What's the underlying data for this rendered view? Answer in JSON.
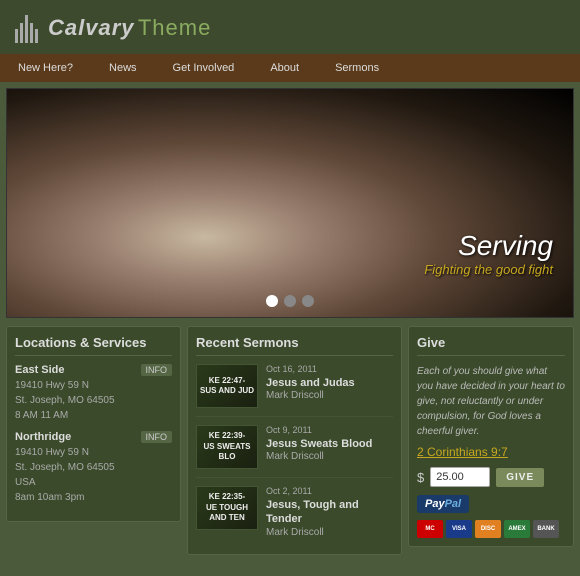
{
  "header": {
    "logo_calvary": "Calvary",
    "logo_theme": "Theme"
  },
  "nav": {
    "items": [
      {
        "label": "New Here?",
        "href": "#"
      },
      {
        "label": "News",
        "href": "#"
      },
      {
        "label": "Get Involved",
        "href": "#"
      },
      {
        "label": "About",
        "href": "#"
      },
      {
        "label": "Sermons",
        "href": "#"
      }
    ]
  },
  "hero": {
    "title": "Serving",
    "subtitle": "Fighting the good fight",
    "dots": [
      {
        "active": true
      },
      {
        "active": false
      },
      {
        "active": false
      }
    ]
  },
  "locations": {
    "section_title": "Locations & Services",
    "items": [
      {
        "name": "East Side",
        "address1": "19410 Hwy 59 N",
        "address2": "St. Joseph, MO 64505",
        "country": "",
        "times": "8 AM   11 AM",
        "info_label": "INFO"
      },
      {
        "name": "Northridge",
        "address1": "19410 Hwy 59 N",
        "address2": "St. Joseph, MO 64505",
        "country": "USA",
        "times": "8am  10am  3pm",
        "info_label": "INFO"
      }
    ]
  },
  "sermons": {
    "section_title": "Recent Sermons",
    "items": [
      {
        "date": "Oct 16, 2011",
        "thumb_line1": "KE 22:47-",
        "thumb_line2": "SUS AND JUD",
        "title": "Jesus and Judas",
        "speaker": "Mark Driscoll"
      },
      {
        "date": "Oct 9, 2011",
        "thumb_line1": "KE 22:39-",
        "thumb_line2": "US SWEATS BLO",
        "title": "Jesus Sweats Blood",
        "speaker": "Mark Driscoll"
      },
      {
        "date": "Oct 2, 2011",
        "thumb_line1": "KE 22:35-",
        "thumb_line2": "UE TOUGH AND TEN",
        "title": "Jesus, Tough and Tender",
        "speaker": "Mark Driscoll"
      }
    ]
  },
  "give": {
    "section_title": "Give",
    "body_text": "Each of you should give what you have decided in your heart to give, not reluctantly or under compulsion, for God loves a cheerful giver.",
    "reference": "2 Corinthians 9:7",
    "amount_default": "25.00",
    "give_label": "GIVE",
    "paypal_label": "PayPal",
    "cards": [
      {
        "label": "MC",
        "type": "mc"
      },
      {
        "label": "VISA",
        "type": "visa"
      },
      {
        "label": "DISC",
        "type": "disc"
      },
      {
        "label": "AMEX",
        "type": "amex"
      },
      {
        "label": "BANK",
        "type": "bank"
      }
    ]
  }
}
